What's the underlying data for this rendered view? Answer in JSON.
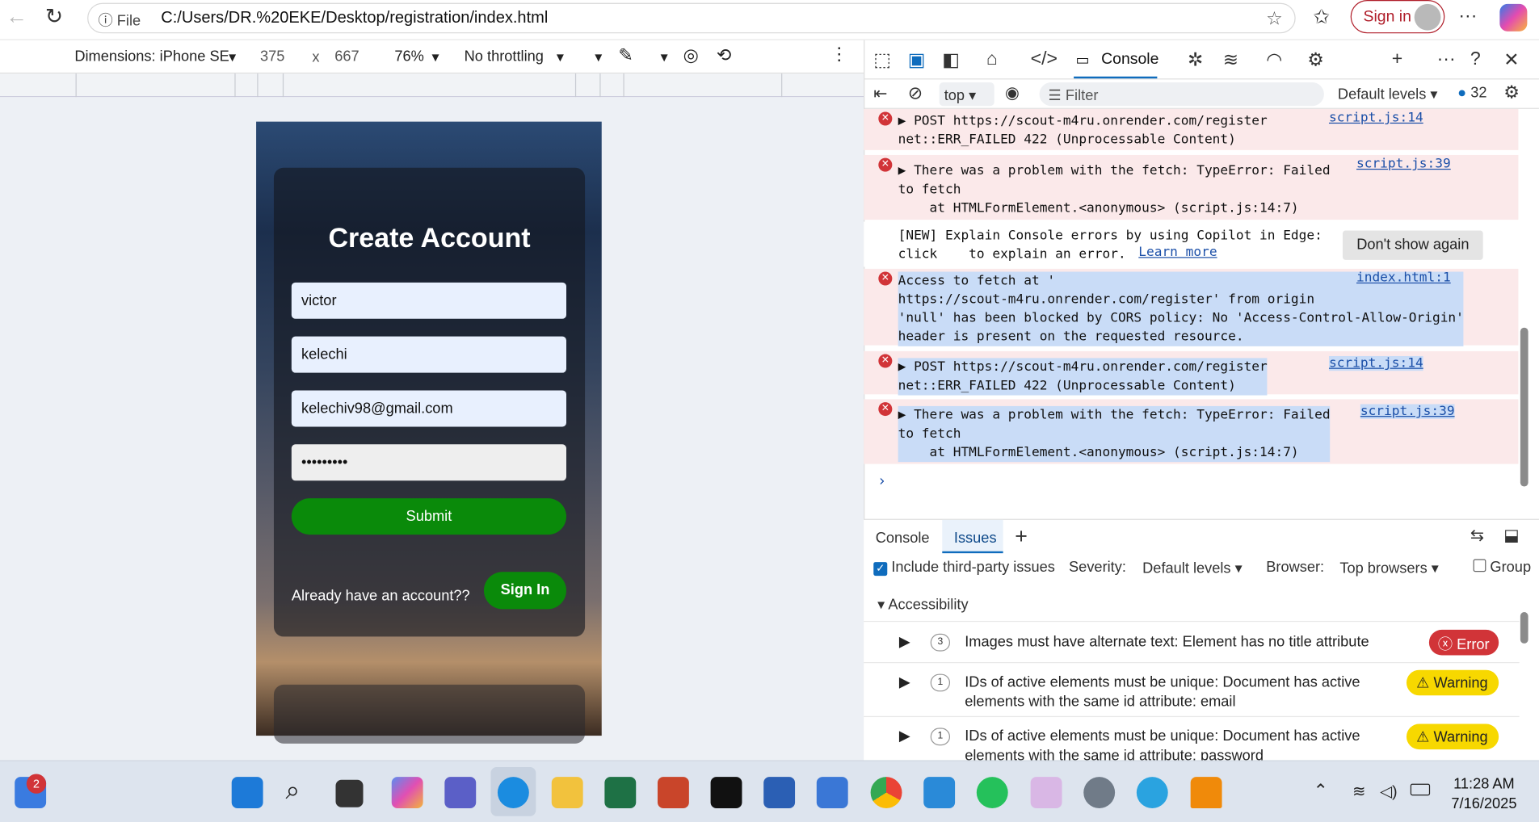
{
  "browser": {
    "address_prefix": "File",
    "url": "C:/Users/DR.%20EKE/Desktop/registration/index.html",
    "signin_label": "Sign in"
  },
  "device_toolbar": {
    "dimensions_label": "Dimensions: iPhone SE",
    "width": "375",
    "x": "x",
    "height": "667",
    "zoom": "76%",
    "throttling": "No throttling"
  },
  "page": {
    "title": "Create Account",
    "fields": [
      "victor",
      "kelechi",
      "kelechiv98@gmail.com",
      "•••••••••"
    ],
    "submit": "Submit",
    "already": "Already have an account??",
    "signin": "Sign In"
  },
  "devtools": {
    "console_tab": "Console",
    "context": "top",
    "filter_placeholder": "Filter",
    "levels": "Default levels",
    "message_count": "32",
    "log": [
      {
        "text": "▶ POST https://scout-m4ru.onrender.com/register\nnet::ERR_FAILED 422 (Unprocessable Content)",
        "source": "script.js:14"
      },
      {
        "text": "▶ There was a problem with the fetch: TypeError: Failed\nto fetch\n    at HTMLFormElement.<anonymous> (script.js:14:7)",
        "source": "script.js:39"
      },
      {
        "text": "[NEW] Explain Console errors by using Copilot in Edge:\nclick    to explain an error.",
        "link": "Learn more",
        "button": "Don't show again"
      },
      {
        "text": "Access to fetch at '\nhttps://scout-m4ru.onrender.com/register' from origin\n'null' has been blocked by CORS policy: No 'Access-Control-Allow-Origin'\nheader is present on the requested resource.",
        "source": "index.html:1"
      },
      {
        "text": "▶ POST https://scout-m4ru.onrender.com/register\nnet::ERR_FAILED 422 (Unprocessable Content)",
        "source": "script.js:14"
      },
      {
        "text": "▶ There was a problem with the fetch: TypeError: Failed\nto fetch\n    at HTMLFormElement.<anonymous> (script.js:14:7)",
        "source": "script.js:39"
      }
    ],
    "drawer_tabs": [
      "Console",
      "Issues"
    ],
    "issues_options": {
      "third_party": "Include third-party issues",
      "severity": "Severity:",
      "severity_value": "Default levels",
      "browser": "Browser:",
      "browser_value": "Top browsers",
      "group": "Group"
    },
    "issues_section": "Accessibility",
    "issues": [
      {
        "count": "3",
        "text": "Images must have alternate text: Element has no title attribute",
        "badge": "Error"
      },
      {
        "count": "1",
        "text": "IDs of active elements must be unique: Document has active\nelements with the same id attribute: email",
        "badge": "Warning"
      },
      {
        "count": "1",
        "text": "IDs of active elements must be unique: Document has active\nelements with the same id attribute: password",
        "badge": "Warning"
      }
    ]
  },
  "taskbar": {
    "notification_badge": "2",
    "time": "11:28 AM",
    "date": "7/16/2025"
  }
}
